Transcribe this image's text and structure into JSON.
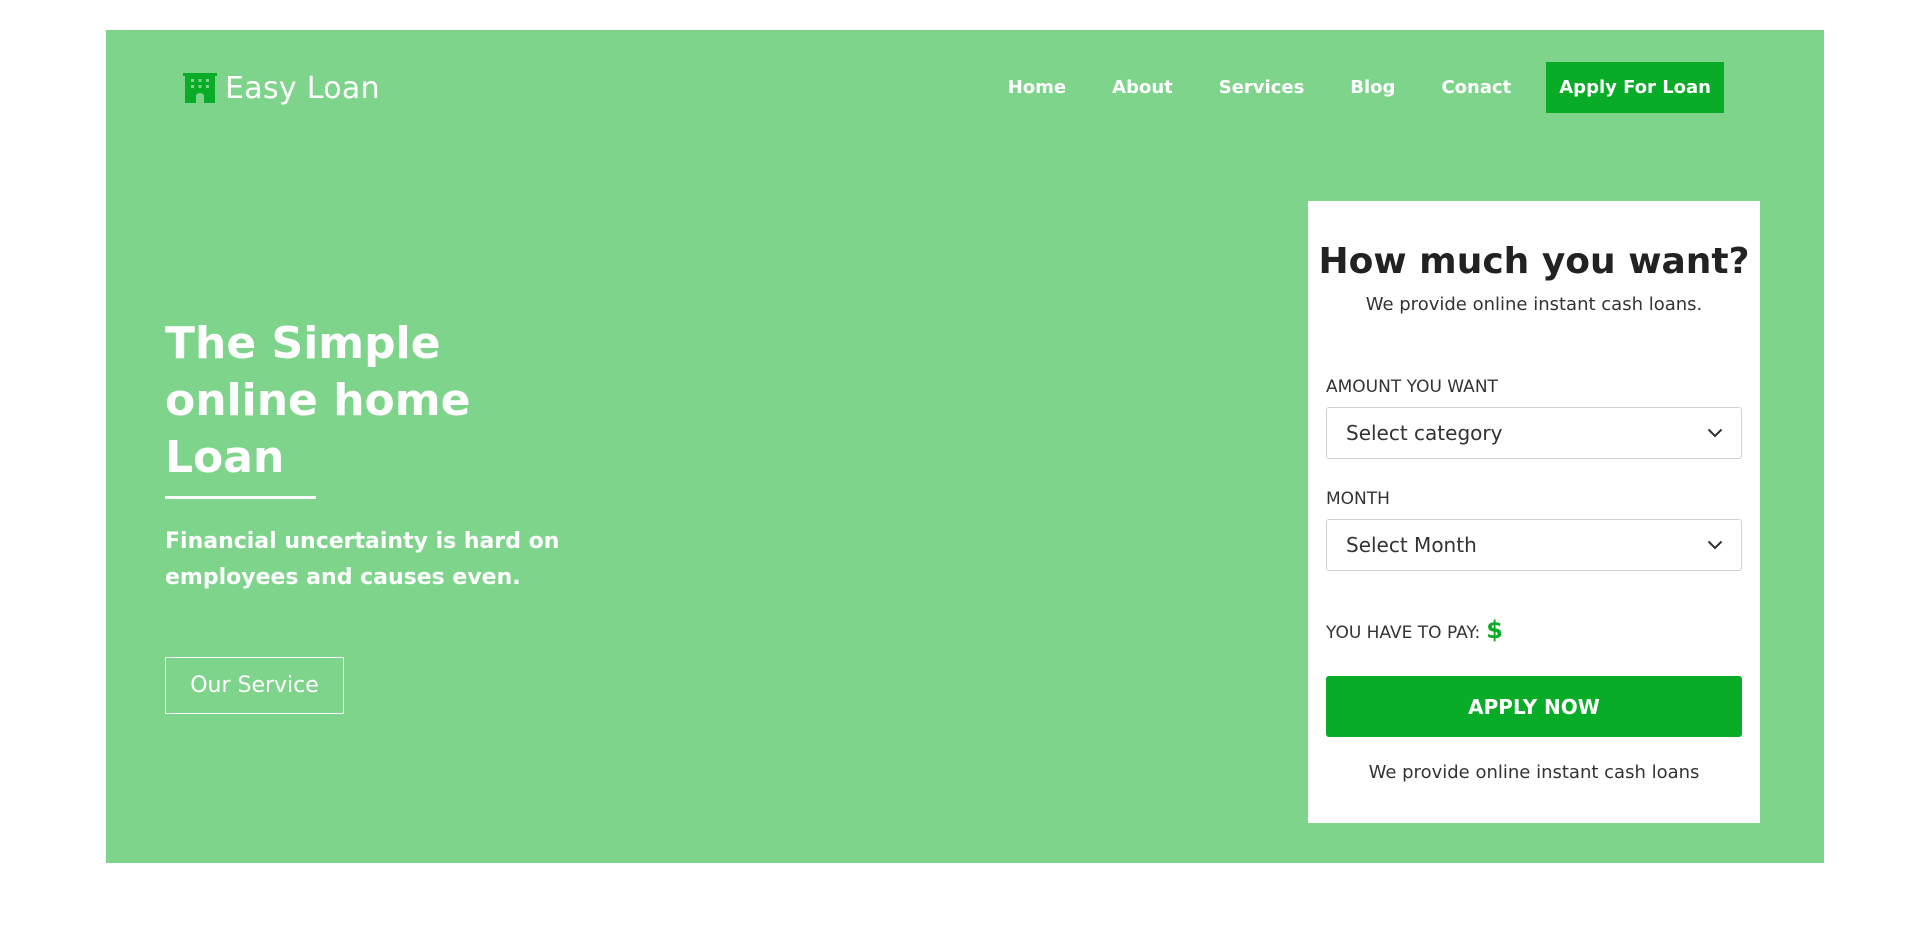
{
  "brand": {
    "name": "Easy Loan",
    "icon": "building-icon"
  },
  "nav": {
    "items": [
      "Home",
      "About",
      "Services",
      "Blog",
      "Conact"
    ],
    "cta_label": "Apply For Loan"
  },
  "hero": {
    "headline_lines": [
      "The Simple",
      "online home",
      "Loan"
    ],
    "subtext": "Financial uncertainty is hard on employees and causes even.",
    "button_label": "Our Service"
  },
  "form": {
    "title": "How much you want?",
    "subtitle": "We provide online instant cash loans.",
    "amount_label": "AMOUNT YOU WANT",
    "amount_selected": "Select category",
    "month_label": "MONTH",
    "month_selected": "Select Month",
    "pay_label": "YOU HAVE TO PAY:",
    "pay_value": "$",
    "apply_label": "APPLY NOW",
    "footer": "We provide online instant cash loans"
  },
  "colors": {
    "hero_background": "#7fd48c",
    "accent_green": "#08ac27",
    "card_background": "#ffffff"
  }
}
